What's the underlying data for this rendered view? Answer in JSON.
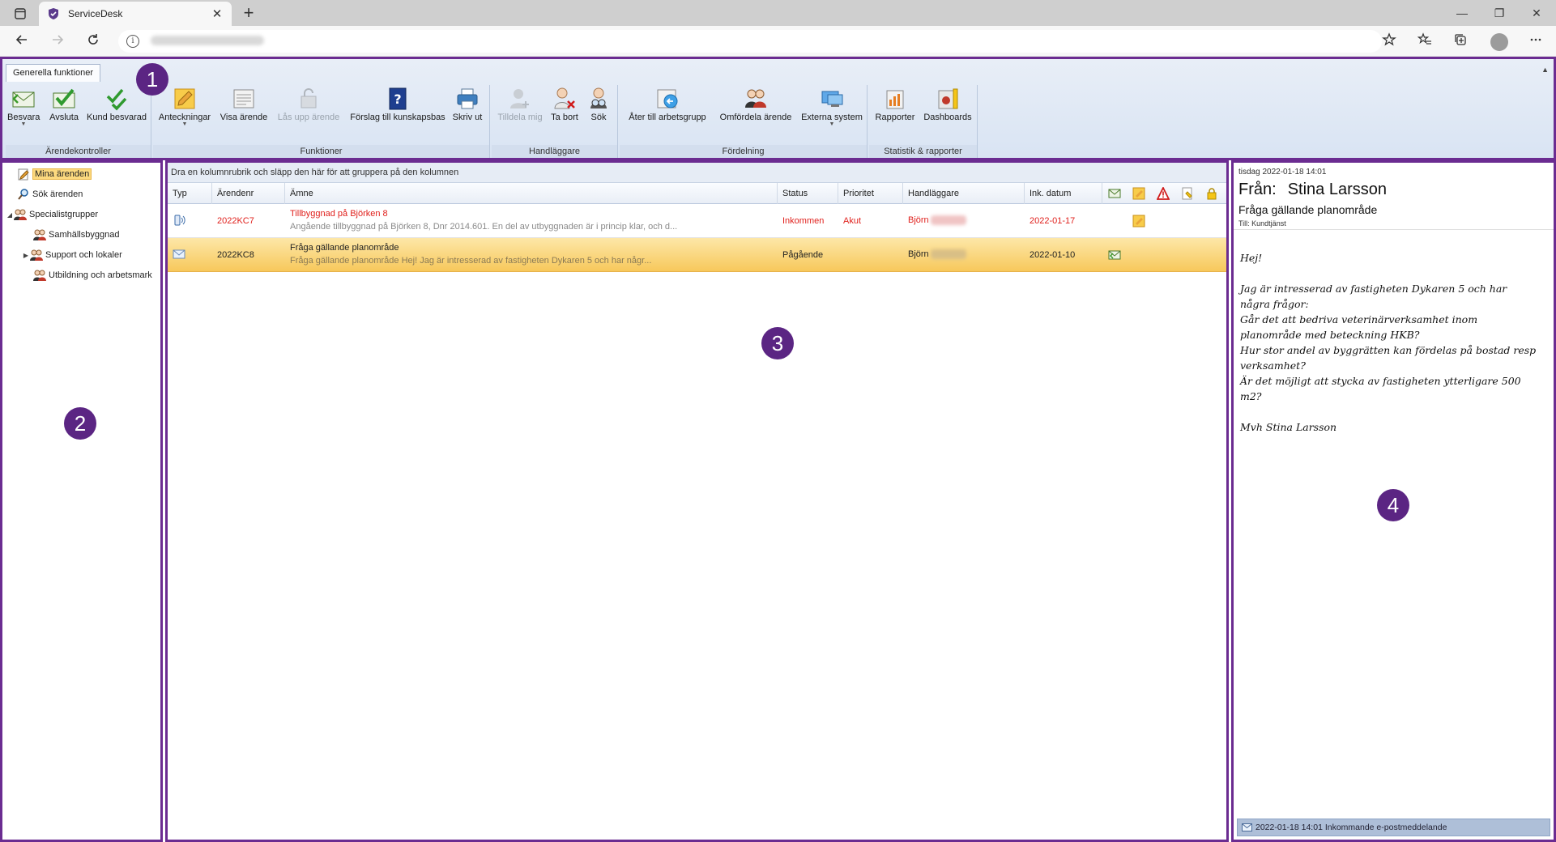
{
  "browser": {
    "tab_title": "ServiceDesk",
    "tab_close": "✕",
    "new_tab": "+",
    "min": "—",
    "restore": "❐",
    "close": "✕"
  },
  "ribbon": {
    "tab": "Generella funktioner",
    "groups": {
      "arende": {
        "label": "Ärendekontroller",
        "besvara": "Besvara",
        "avsluta": "Avsluta",
        "kund_besvarad": "Kund besvarad"
      },
      "funktioner": {
        "label": "Funktioner",
        "anteckningar": "Anteckningar",
        "visa_arende": "Visa ärende",
        "las_upp": "Lås upp ärende",
        "forslag": "Förslag till kunskapsbas",
        "skriv_ut": "Skriv ut"
      },
      "handlaggare": {
        "label": "Handläggare",
        "tilldela": "Tilldela mig",
        "ta_bort": "Ta bort",
        "sok": "Sök"
      },
      "fordelning": {
        "label": "Fördelning",
        "ater": "Åter till arbetsgrupp",
        "omfordela": "Omfördela ärende",
        "externa": "Externa system"
      },
      "statistik": {
        "label": "Statistik & rapporter",
        "rapporter": "Rapporter",
        "dashboards": "Dashboards"
      }
    }
  },
  "badges": [
    "1",
    "2",
    "3",
    "4"
  ],
  "tree": {
    "mina": "Mina ärenden",
    "sok": "Sök ärenden",
    "specialist": "Specialistgrupper",
    "samhall": "Samhällsbyggnad",
    "support": "Support och lokaler",
    "utbildning": "Utbildning och arbetsmark"
  },
  "grid": {
    "group_hint": "Dra en kolumnrubrik och släpp den här för att gruppera på den kolumnen",
    "headers": {
      "typ": "Typ",
      "arendenr": "Ärendenr",
      "amne": "Ämne",
      "status": "Status",
      "prioritet": "Prioritet",
      "handlaggare": "Handläggare",
      "ink_datum": "Ink. datum"
    },
    "rows": [
      {
        "nr": "2022KC7",
        "subject": "Tillbyggnad på Björken 8",
        "preview": "Angående tillbyggnad på Björken 8, Dnr 2014.601. En del av utbyggnaden är i princip klar, och d...",
        "status": "Inkommen",
        "priority": "Akut",
        "handler": "Björn",
        "date": "2022-01-17"
      },
      {
        "nr": "2022KC8",
        "subject": "Fråga gällande planområde",
        "preview": "Fråga gällande planområde Hej! Jag är intresserad av fastigheten Dykaren 5 och har någr...",
        "status": "Pågående",
        "priority": "",
        "handler": "Björn",
        "date": "2022-01-10"
      }
    ]
  },
  "preview": {
    "date": "tisdag 2022-01-18 14:01",
    "from_label": "Från:",
    "from_name": "Stina Larsson",
    "subject": "Fråga gällande planområde",
    "to": "Till: Kundtjänst",
    "body": {
      "l1": "Hej!",
      "l2": "Jag är intresserad av fastigheten Dykaren 5 och har",
      "l3": "några frågor:",
      "l4": "Går det att bedriva veterinärverksamhet inom",
      "l5": "planområde med beteckning HKB?",
      "l6": "Hur stor andel av byggrätten kan fördelas på bostad resp",
      "l7": "verksamhet?",
      "l8": "Är det möjligt att stycka av fastigheten ytterligare 500",
      "l9": "m2?",
      "l10": "Mvh Stina Larsson"
    },
    "footer": "2022-01-18 14:01 Inkommande e-postmeddelande"
  }
}
